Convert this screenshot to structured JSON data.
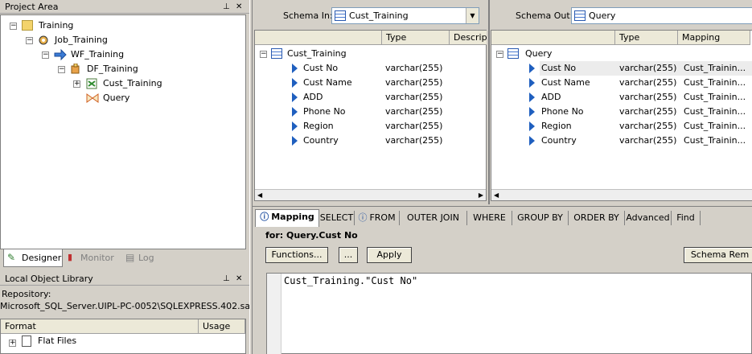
{
  "project": {
    "title": "Project Area",
    "tree": [
      "Training",
      "Job_Training",
      "WF_Training",
      "DF_Training",
      "Cust_Training",
      "Query"
    ],
    "tabs": [
      "Designer",
      "Monitor",
      "Log"
    ]
  },
  "library": {
    "title": "Local Object Library",
    "repo_label": "Repository:",
    "repo_value": "Microsoft_SQL_Server.UIPL-PC-0052\\SQLEXPRESS.402.sa",
    "col_format": "Format",
    "col_usage": "Usage",
    "items": [
      "Flat Files"
    ]
  },
  "schema_in": {
    "label": "Schema In:",
    "value": "Cust_Training",
    "col_type": "Type",
    "col_desc": "Descripti",
    "root": "Cust_Training",
    "rows": [
      {
        "name": "Cust No",
        "type": "varchar(255)"
      },
      {
        "name": "Cust Name",
        "type": "varchar(255)"
      },
      {
        "name": "ADD",
        "type": "varchar(255)"
      },
      {
        "name": "Phone No",
        "type": "varchar(255)"
      },
      {
        "name": "Region",
        "type": "varchar(255)"
      },
      {
        "name": "Country",
        "type": "varchar(255)"
      }
    ]
  },
  "schema_out": {
    "label": "Schema Out:",
    "value": "Query",
    "col_type": "Type",
    "col_mapping": "Mapping",
    "root": "Query",
    "rows": [
      {
        "name": "Cust No",
        "type": "varchar(255)",
        "mapping": "Cust_Trainin..."
      },
      {
        "name": "Cust Name",
        "type": "varchar(255)",
        "mapping": "Cust_Trainin..."
      },
      {
        "name": "ADD",
        "type": "varchar(255)",
        "mapping": "Cust_Trainin..."
      },
      {
        "name": "Phone No",
        "type": "varchar(255)",
        "mapping": "Cust_Trainin..."
      },
      {
        "name": "Region",
        "type": "varchar(255)",
        "mapping": "Cust_Trainin..."
      },
      {
        "name": "Country",
        "type": "varchar(255)",
        "mapping": "Cust_Trainin..."
      }
    ]
  },
  "mapping": {
    "tabs": [
      "Mapping",
      "SELECT",
      "FROM",
      "OUTER JOIN",
      "WHERE",
      "GROUP BY",
      "ORDER BY",
      "Advanced",
      "Find"
    ],
    "for_label": "for: Query.Cust No",
    "functions_btn": "Functions...",
    "ellipsis_btn": "...",
    "apply_btn": "Apply",
    "schema_remap_btn": "Schema Rem",
    "expression": "Cust_Training.\"Cust No\""
  },
  "icons": {
    "table": "table-icon",
    "arrow": "column-arrow-icon",
    "folder": "folder-icon",
    "pin": "pin-icon",
    "close": "close-icon"
  }
}
